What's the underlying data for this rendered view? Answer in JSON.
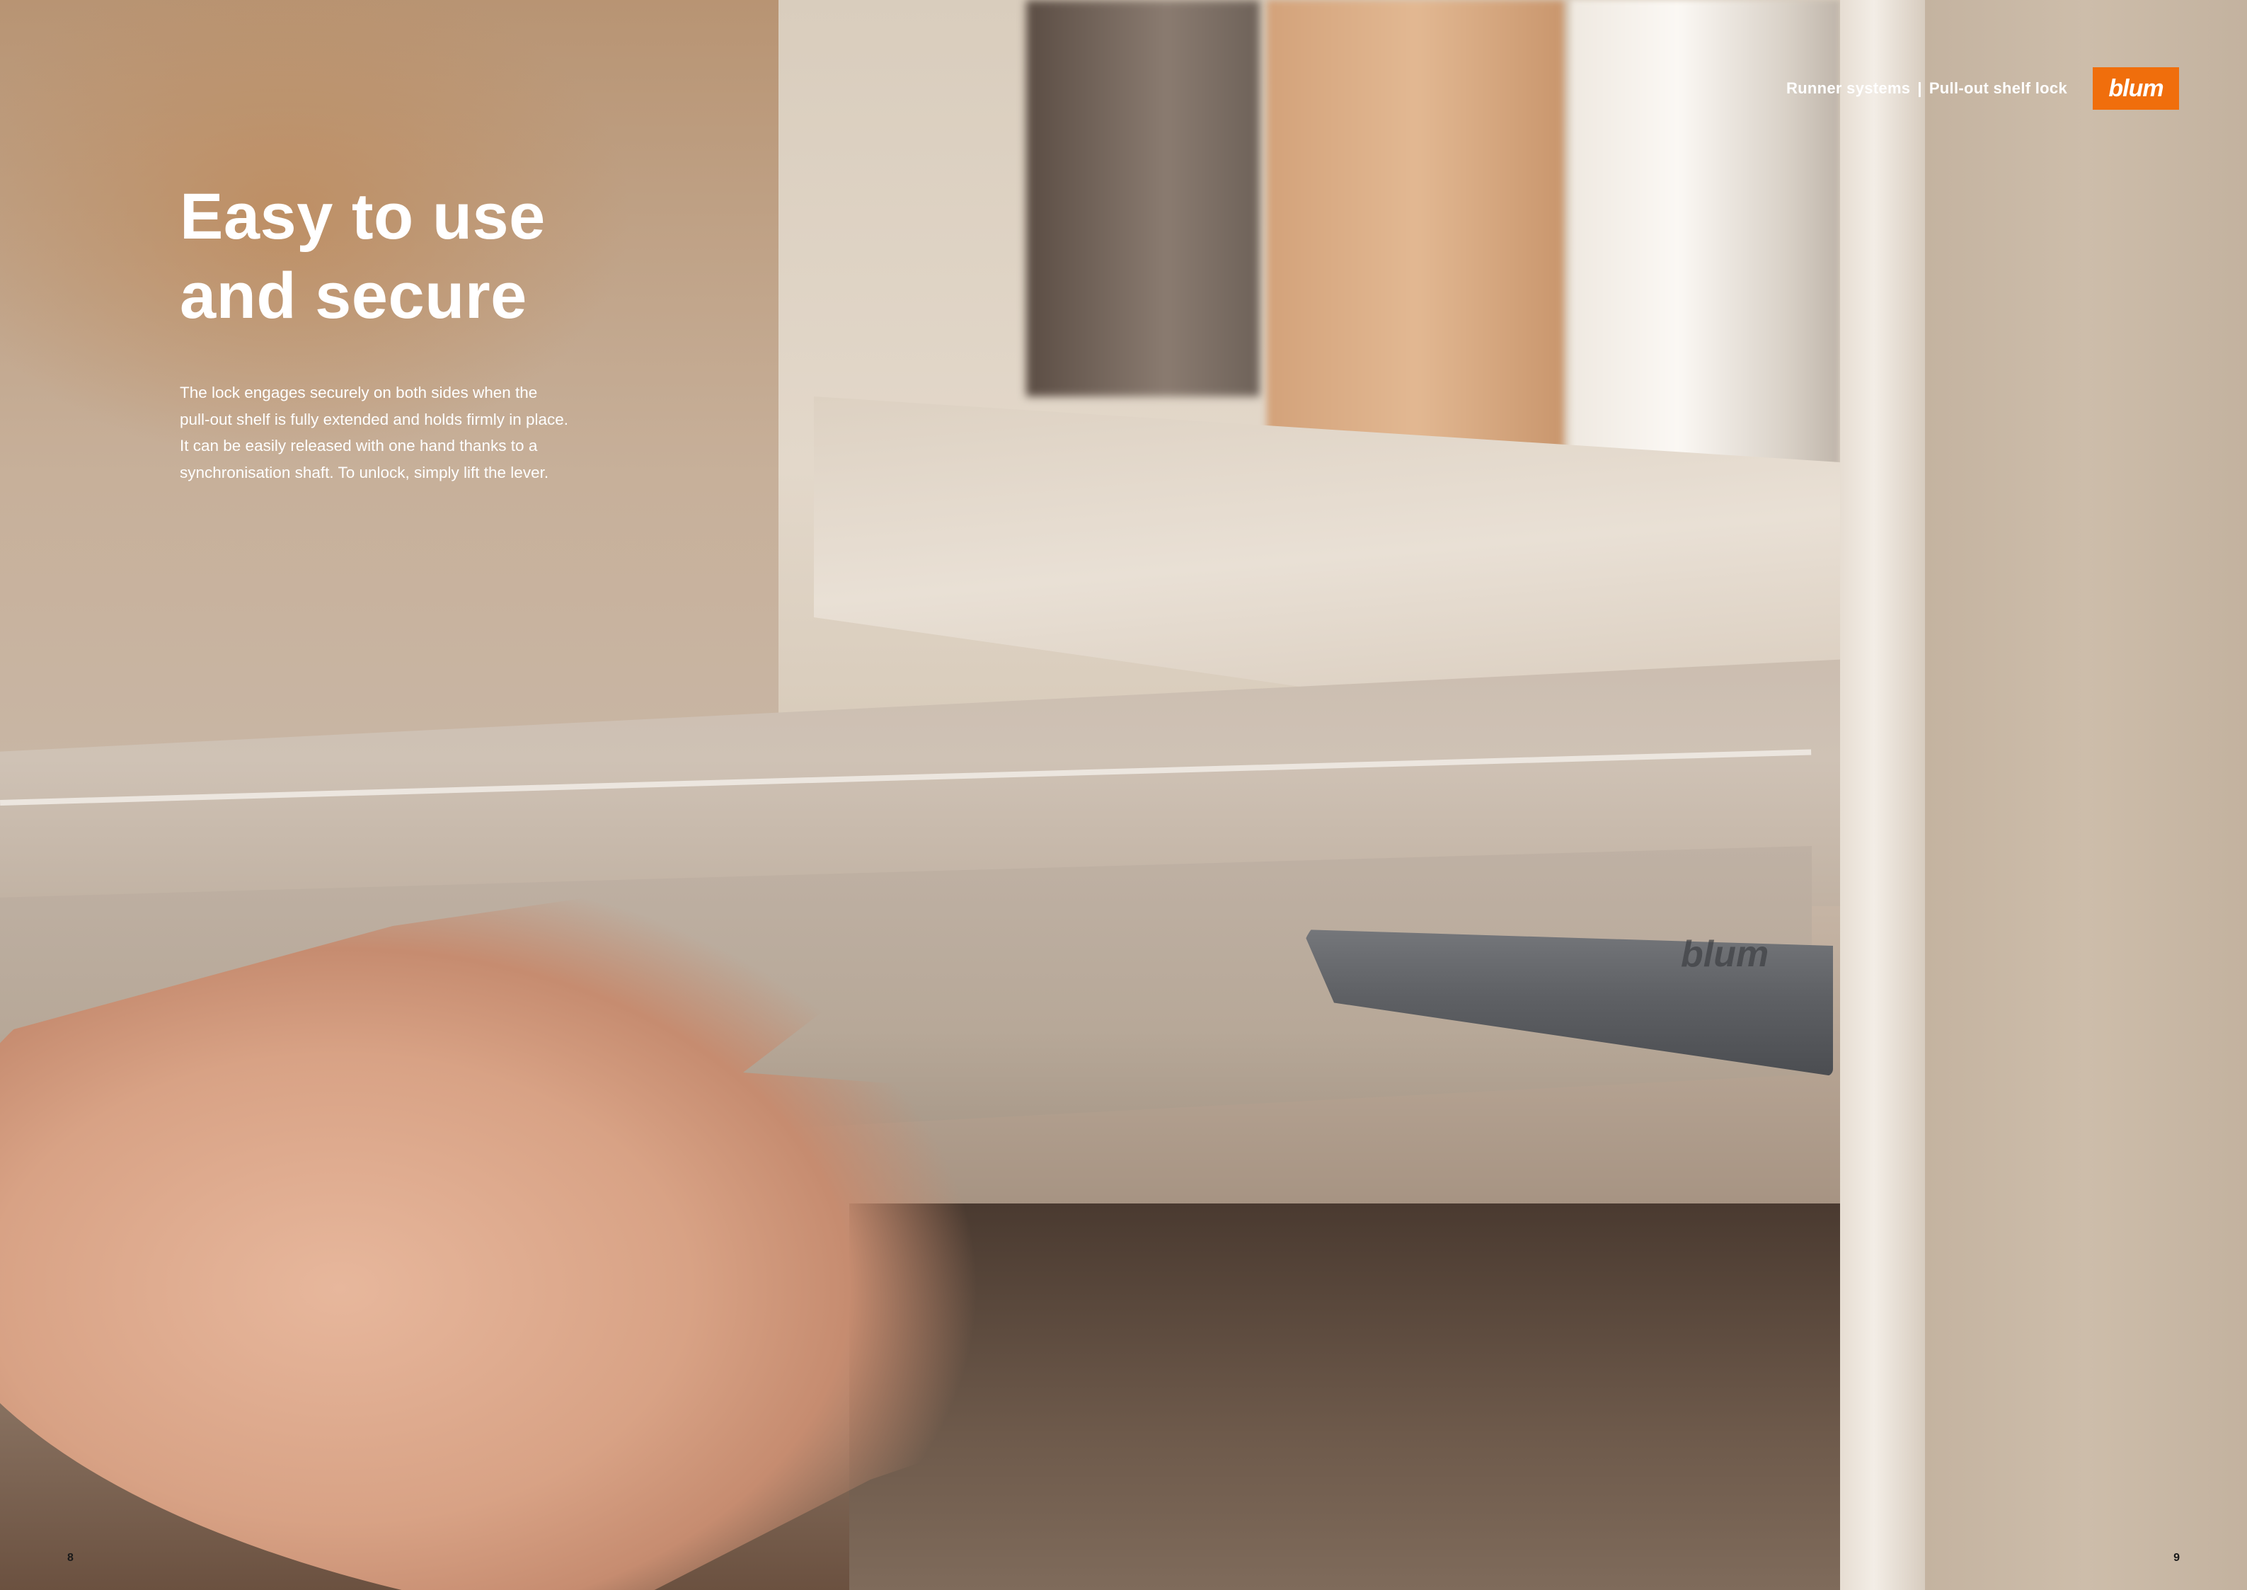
{
  "header": {
    "section": "Runner systems",
    "separator": "|",
    "topic": "Pull-out shelf lock"
  },
  "logo": {
    "text": "blum",
    "color": "#f06e0c"
  },
  "title_lines": [
    "Easy to use",
    "and secure"
  ],
  "body_lines": [
    "The lock engages securely on both sides when the",
    "pull-out shelf is fully extended and holds firmly in place.",
    "It can be easily released with one hand thanks to a",
    "synchronisation shaft. To unlock, simply lift the lever."
  ],
  "product_mark": "blum",
  "page_numbers": {
    "left": "8",
    "right": "9"
  }
}
